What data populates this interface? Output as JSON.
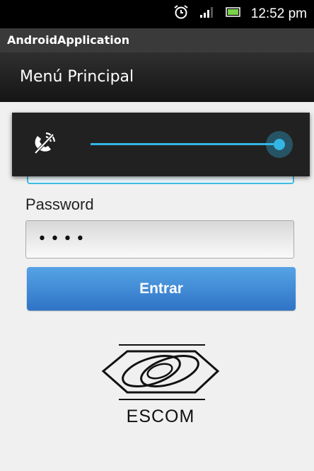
{
  "status_bar": {
    "time": "12:52 pm",
    "icons": [
      "alarm-icon",
      "signal-icon",
      "battery-icon"
    ]
  },
  "app": {
    "title": "AndroidApplication"
  },
  "action_bar": {
    "title": "Menú Principal"
  },
  "form": {
    "password_label": "Password",
    "password_value": "••••",
    "enter_label": "Entrar"
  },
  "logo": {
    "text": "ESCOM"
  },
  "volume": {
    "stream_icon": "phone-ringer-icon",
    "level": 1.0
  },
  "colors": {
    "accent": "#33b5e5",
    "button": "#3e86d4"
  }
}
